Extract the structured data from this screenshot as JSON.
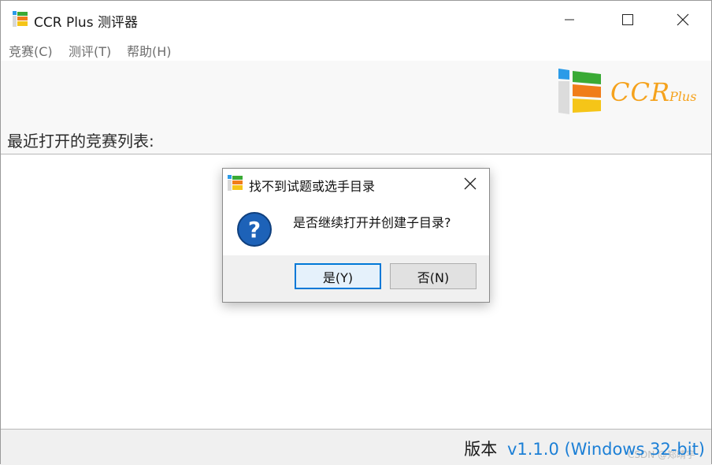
{
  "window": {
    "title": "CCR Plus 测评器",
    "menus": [
      "竞赛(C)",
      "测评(T)",
      "帮助(H)"
    ]
  },
  "banner": {
    "logo_text": "CCR",
    "logo_sub": "Plus"
  },
  "main": {
    "recent_label": "最近打开的竞赛列表:"
  },
  "status": {
    "version_label": "版本",
    "version_value": "v1.1.0 (Windows 32-bit)",
    "watermark": "CSDN @郑晴宇"
  },
  "dialog": {
    "title": "找不到试题或选手目录",
    "message": "是否继续打开并创建子目录?",
    "yes_label": "是(Y)",
    "no_label": "否(N)"
  },
  "colors": {
    "accent": "#0078d7",
    "version_blue": "#1b7fd6",
    "logo_orange": "#f5a21c",
    "question_blue": "#1d62b8"
  },
  "icons": [
    "app-icon",
    "minimize-icon",
    "maximize-icon",
    "close-icon",
    "question-icon"
  ]
}
